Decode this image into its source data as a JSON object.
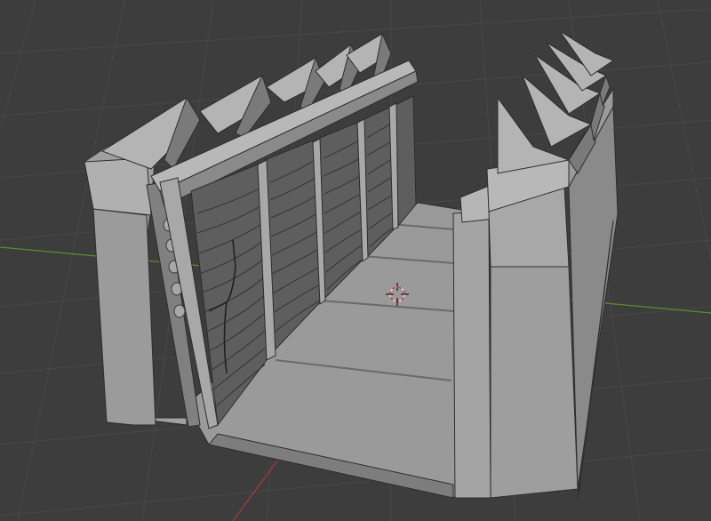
{
  "viewport": {
    "background": "#3d3d3d",
    "grid_color": "#4a4a4a",
    "x_axis_color": "#a33a3a",
    "y_axis_color": "#5c8a2e"
  },
  "scene": {
    "mesh_color": "#a2a2a2",
    "shadow_color": "#6a6a6a",
    "edge_color": "#2e2e2e",
    "cursor_icon": "3d-cursor-icon"
  }
}
